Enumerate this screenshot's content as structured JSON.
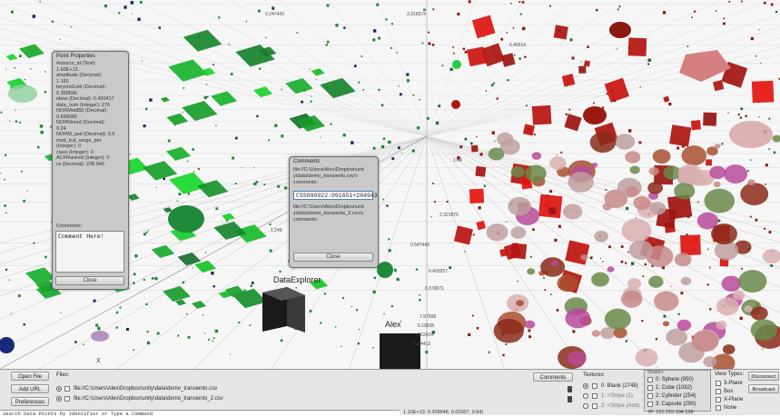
{
  "scene": {
    "label_dataexplorer": "DataExplorer",
    "label_alex": "Alex",
    "axis_x": "X",
    "axis_ticks": [
      "0.247443",
      "3.316574",
      "5.45614",
      "2.321875",
      "1.249",
      "1.04",
      "0.547443",
      "0.403257",
      "0.379071",
      "7.97658",
      "5.19208",
      "4.52414",
      "6.34413"
    ]
  },
  "point_properties": {
    "title": "Point Properties",
    "rows": [
      "#source_id (Text):",
      "1.60E+13",
      "amplitude (Decimal):",
      "1.165",
      "beyond1std (Decimal):",
      "0.358696",
      "skew (Decimal): 0.420417",
      "data_num (Integer): 276",
      "NORMstd50 (Decimal):",
      "0.848086",
      "NORMmad (Decimal):",
      "0.24",
      "NORM_psd (Decimal): 0.6",
      "med_buf_range_per",
      "(Integer): 0",
      "class (Integer): 0",
      "ACFRanked (Integer): 0",
      "ra (Decimal): 238.046"
    ],
    "comments_label": "Comments:",
    "comment_value": "Comment Here!",
    "close_label": "Close"
  },
  "comments_panel": {
    "title": "Comments",
    "file1_lines": [
      "file://C:\\Users\\Alex\\Dropbox\\unit",
      "y\\data\\demo_transients.csv's",
      "comments:"
    ],
    "input_value": "CSS090922:091651+284943",
    "file2_lines": [
      "file://C:\\Users\\Alex\\Dropbox\\unit",
      "y\\data\\demo_transients_2.csv's",
      "comments:"
    ],
    "close_label": "Close"
  },
  "bottom": {
    "open_file": "Open File",
    "add_url": "Add URL",
    "preferences": "Preferences",
    "files_label": "Files:",
    "files": [
      "file://C:\\Users\\Alex\\Dropbox\\unity\\data\\demo_transients.csv",
      "file://C:\\Users\\Alex\\Dropbox\\unity\\data\\demo_transients_2.csv"
    ],
    "comments_button": "Comments",
    "textures_label": "Textures:",
    "textures": [
      "0: Blank (2748)",
      "1: <Stripe (1)",
      "2: <Stripe (Add)"
    ],
    "shapes_label": "Shapes:",
    "shapes": [
      "0: Sphere (950)",
      "1: Cube (1082)",
      "2: Cylinder (254)",
      "3: Capsule (290)"
    ],
    "view_types_label": "View Types:",
    "view_types": [
      "3-Plane",
      "Box",
      "X-Plane",
      "None"
    ],
    "disconnect": "Disconnect",
    "broadcast": "Broadcast",
    "search_placeholder": "Search Data Points by Identifier or Type a Command",
    "status_left": "1.10E+13: 0.208648, 0.01007, 0.94)",
    "status_right": "IP: 131.215.104.138"
  }
}
